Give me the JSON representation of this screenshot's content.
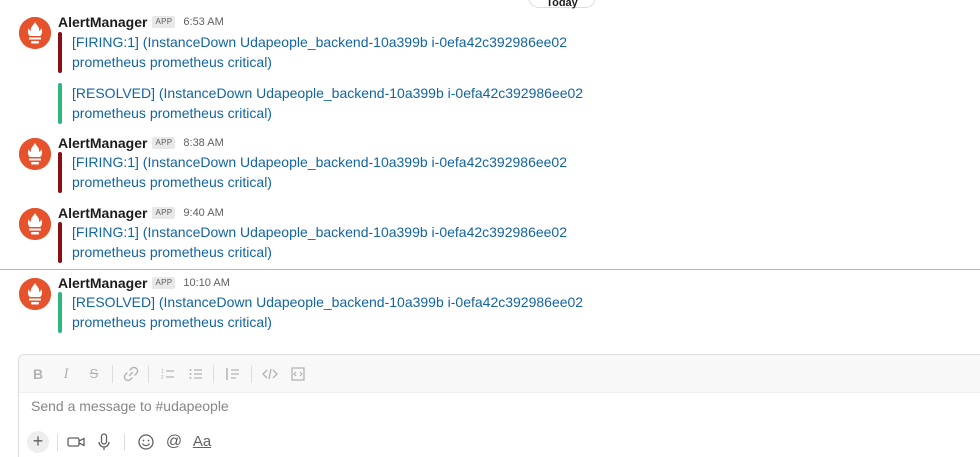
{
  "date_divider": "Today",
  "messages": [
    {
      "sender": "AlertManager",
      "badge": "APP",
      "time": "6:53 AM",
      "attachments": [
        {
          "status": "firing",
          "line1": "[FIRING:1]  (InstanceDown Udapeople_backend-10a399b i-0efa42c392986ee02",
          "line2": "prometheus prometheus critical)"
        },
        {
          "status": "resolved",
          "line1": "[RESOLVED]  (InstanceDown Udapeople_backend-10a399b i-0efa42c392986ee02",
          "line2": "prometheus prometheus critical)"
        }
      ]
    },
    {
      "sender": "AlertManager",
      "badge": "APP",
      "time": "8:38 AM",
      "attachments": [
        {
          "status": "firing",
          "line1": "[FIRING:1]  (InstanceDown Udapeople_backend-10a399b i-0efa42c392986ee02",
          "line2": "prometheus prometheus critical)"
        }
      ]
    },
    {
      "sender": "AlertManager",
      "badge": "APP",
      "time": "9:40 AM",
      "attachments": [
        {
          "status": "firing",
          "line1": "[FIRING:1]  (InstanceDown Udapeople_backend-10a399b i-0efa42c392986ee02",
          "line2": "prometheus prometheus critical)"
        }
      ]
    },
    {
      "sender": "AlertManager",
      "badge": "APP",
      "time": "10:10 AM",
      "attachments": [
        {
          "status": "resolved",
          "line1": "[RESOLVED]  (InstanceDown Udapeople_backend-10a399b i-0efa42c392986ee02",
          "line2": "prometheus prometheus critical)"
        }
      ]
    }
  ],
  "composer": {
    "placeholder": "Send a message to #udapeople",
    "format_buttons": [
      "bold",
      "italic",
      "strikethrough",
      "link",
      "ordered-list",
      "bulleted-list",
      "blockquote",
      "code",
      "code-block"
    ],
    "bottom_buttons": [
      "plus",
      "video",
      "microphone",
      "emoji",
      "mention",
      "formatting"
    ],
    "formatting_label": "Aa",
    "mention_label": "@"
  },
  "colors": {
    "firing": "#8b0e12",
    "resolved": "#2eb67d",
    "link": "#1264a3",
    "avatar": "#e6522c"
  }
}
